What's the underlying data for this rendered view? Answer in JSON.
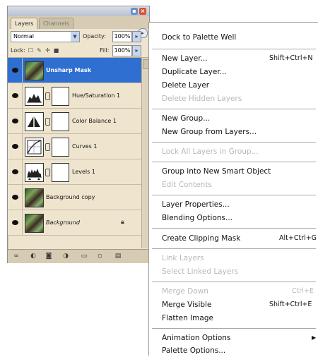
{
  "palette": {
    "tabs": [
      "Layers",
      "Channels"
    ],
    "blend_mode": "Normal",
    "opacity_label": "Opacity:",
    "opacity_value": "100%",
    "lock_label": "Lock:",
    "fill_label": "Fill:",
    "fill_value": "100%",
    "layers": [
      {
        "name": "Unsharp Mask",
        "selected": true,
        "thumb": "image",
        "mask": false
      },
      {
        "name": "Hue/Saturation 1",
        "selected": false,
        "thumb": "adjustment",
        "mask": true
      },
      {
        "name": "Color Balance 1",
        "selected": false,
        "thumb": "adjustment",
        "mask": true
      },
      {
        "name": "Curves 1",
        "selected": false,
        "thumb": "adjustment",
        "mask": true
      },
      {
        "name": "Levels 1",
        "selected": false,
        "thumb": "adjustment",
        "mask": true
      },
      {
        "name": "Background copy",
        "selected": false,
        "thumb": "image",
        "mask": false
      },
      {
        "name": "Background",
        "selected": false,
        "thumb": "image",
        "mask": false,
        "locked": true
      }
    ],
    "bottom_icons": [
      "link-layers-icon",
      "layer-style-icon",
      "add-mask-icon",
      "adjustment-layer-icon",
      "new-group-icon",
      "new-layer-icon",
      "trash-icon"
    ]
  },
  "menu": {
    "items": [
      {
        "label": "Dock to Palette Well",
        "shortcut": "",
        "enabled": true
      },
      {
        "label": "New Layer...",
        "shortcut": "Shift+Ctrl+N",
        "enabled": true
      },
      {
        "label": "Duplicate Layer...",
        "shortcut": "",
        "enabled": true
      },
      {
        "label": "Delete Layer",
        "shortcut": "",
        "enabled": true
      },
      {
        "label": "Delete Hidden Layers",
        "shortcut": "",
        "enabled": false
      },
      {
        "label": "New Group...",
        "shortcut": "",
        "enabled": true
      },
      {
        "label": "New Group from Layers...",
        "shortcut": "",
        "enabled": true
      },
      {
        "label": "Lock All Layers in Group...",
        "shortcut": "",
        "enabled": false
      },
      {
        "label": "Group into New Smart Object",
        "shortcut": "",
        "enabled": true
      },
      {
        "label": "Edit Contents",
        "shortcut": "",
        "enabled": false
      },
      {
        "label": "Layer Properties...",
        "shortcut": "",
        "enabled": true
      },
      {
        "label": "Blending Options...",
        "shortcut": "",
        "enabled": true
      },
      {
        "label": "Create Clipping Mask",
        "shortcut": "Alt+Ctrl+G",
        "enabled": true
      },
      {
        "label": "Link Layers",
        "shortcut": "",
        "enabled": false
      },
      {
        "label": "Select Linked Layers",
        "shortcut": "",
        "enabled": false
      },
      {
        "label": "Merge Down",
        "shortcut": "Ctrl+E",
        "enabled": false
      },
      {
        "label": "Merge Visible",
        "shortcut": "Shift+Ctrl+E",
        "enabled": true
      },
      {
        "label": "Flatten Image",
        "shortcut": "",
        "enabled": true
      },
      {
        "label": "Animation Options",
        "shortcut": "",
        "enabled": true,
        "submenu": true
      },
      {
        "label": "Palette Options...",
        "shortcut": "",
        "enabled": true
      }
    ]
  },
  "colors": {
    "selection": "#2f6fd2",
    "palette_bg": "#efe5cf",
    "disabled_text": "#b8b8b8"
  }
}
